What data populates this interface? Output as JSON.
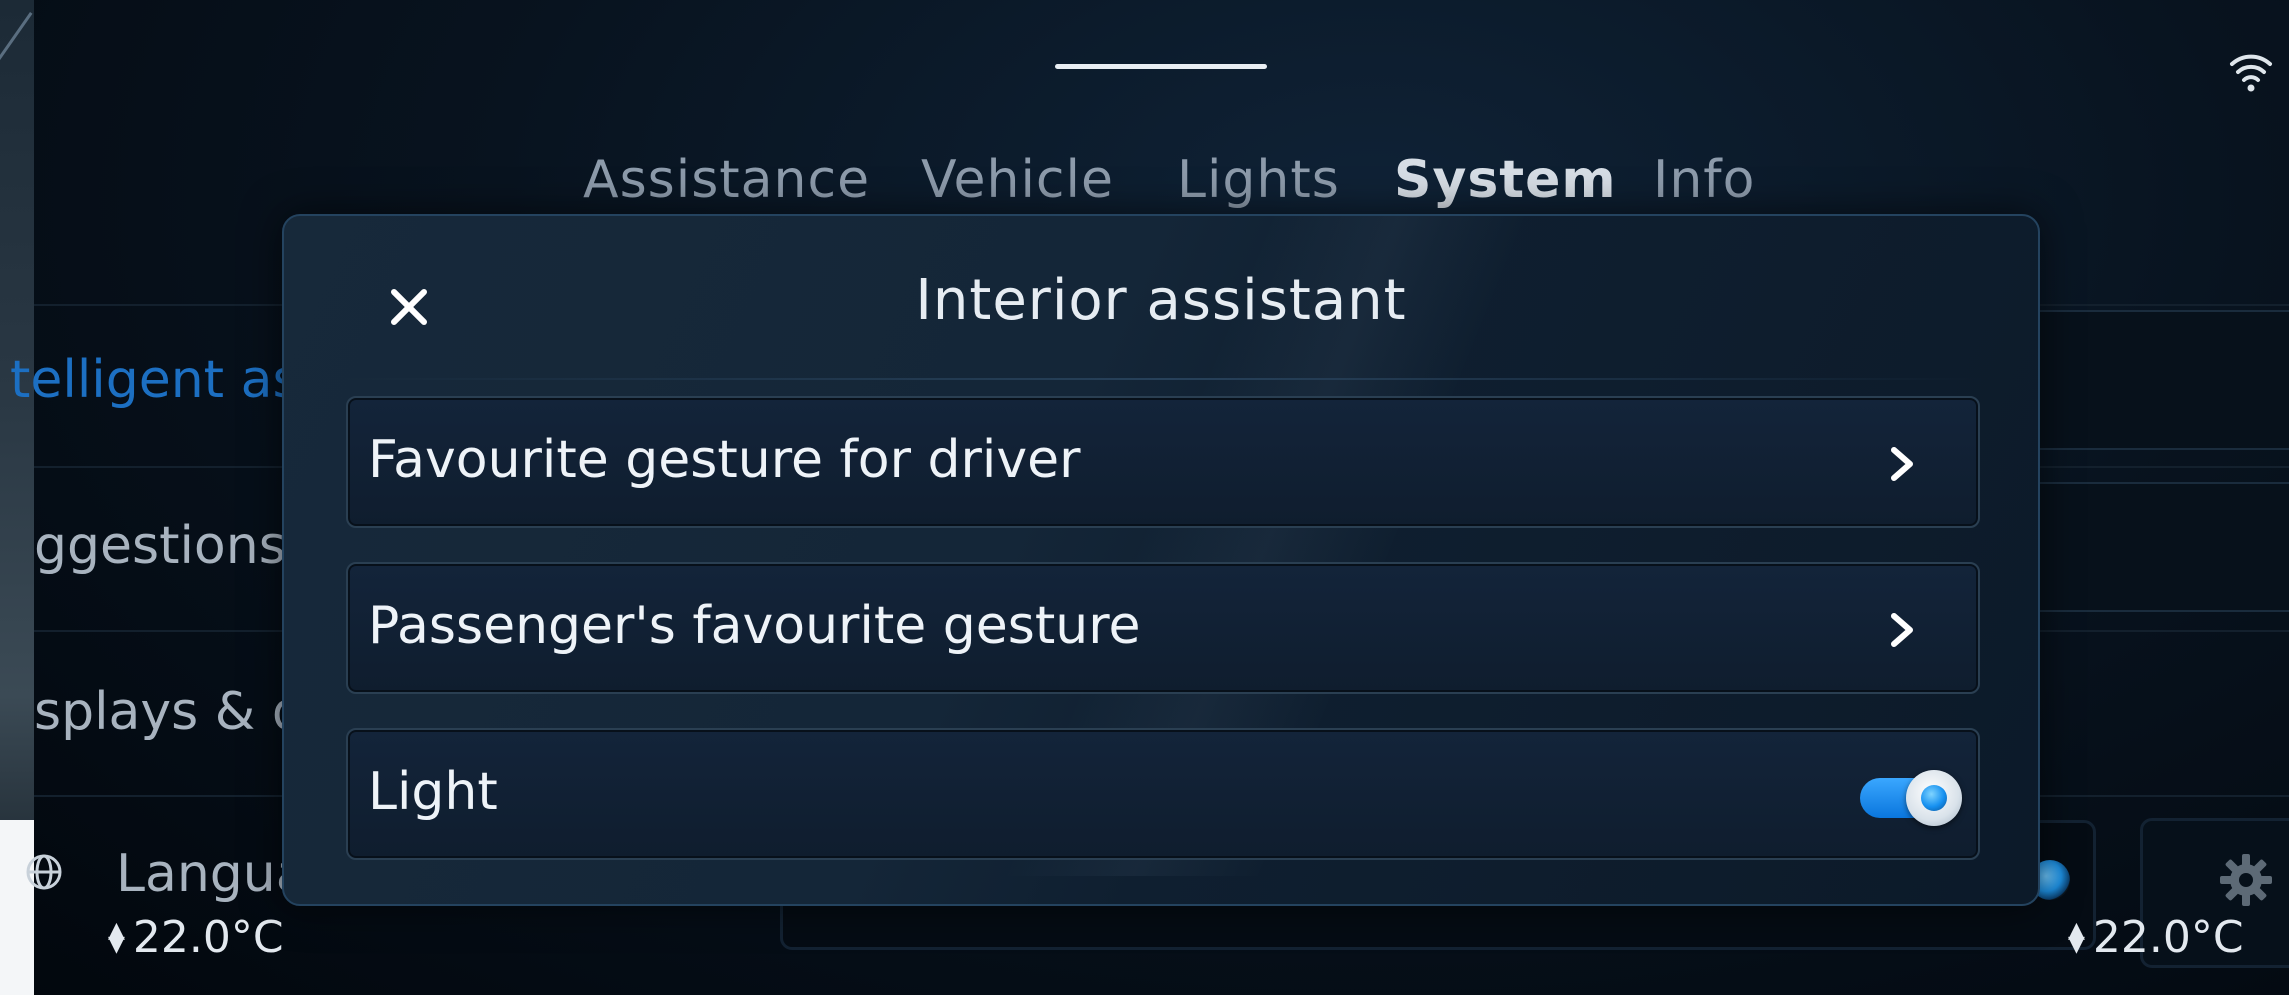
{
  "header": {
    "tabs": [
      {
        "label": "Assistance",
        "active": false
      },
      {
        "label": "Vehicle",
        "active": false
      },
      {
        "label": "Lights",
        "active": false
      },
      {
        "label": "System",
        "active": true
      },
      {
        "label": "Info",
        "active": false
      }
    ]
  },
  "background_list": {
    "items": [
      {
        "label": "telligent as",
        "selected": true
      },
      {
        "label": "ggestions",
        "selected": false
      },
      {
        "label": "splays & dis",
        "selected": false
      },
      {
        "label": "Languag",
        "selected": false,
        "icon": "globe-icon"
      }
    ]
  },
  "modal": {
    "title": "Interior assistant",
    "close_icon": "close-icon",
    "rows": [
      {
        "label": "Favourite gesture for driver",
        "control": "chevron-right-icon"
      },
      {
        "label": "Passenger's favourite gesture",
        "control": "chevron-right-icon"
      },
      {
        "label": "Light",
        "control": "toggle",
        "toggle_on": true
      }
    ]
  },
  "climate": {
    "left_temp": "22.0°C",
    "right_temp": "22.0°C"
  },
  "status": {
    "wifi_icon": "wifi-icon",
    "settings_icon": "gear-icon"
  },
  "colors": {
    "accent_blue": "#1c6fc2",
    "toggle_blue": "#0a76dd",
    "modal_bg": "#142638",
    "background": "#08131f"
  }
}
